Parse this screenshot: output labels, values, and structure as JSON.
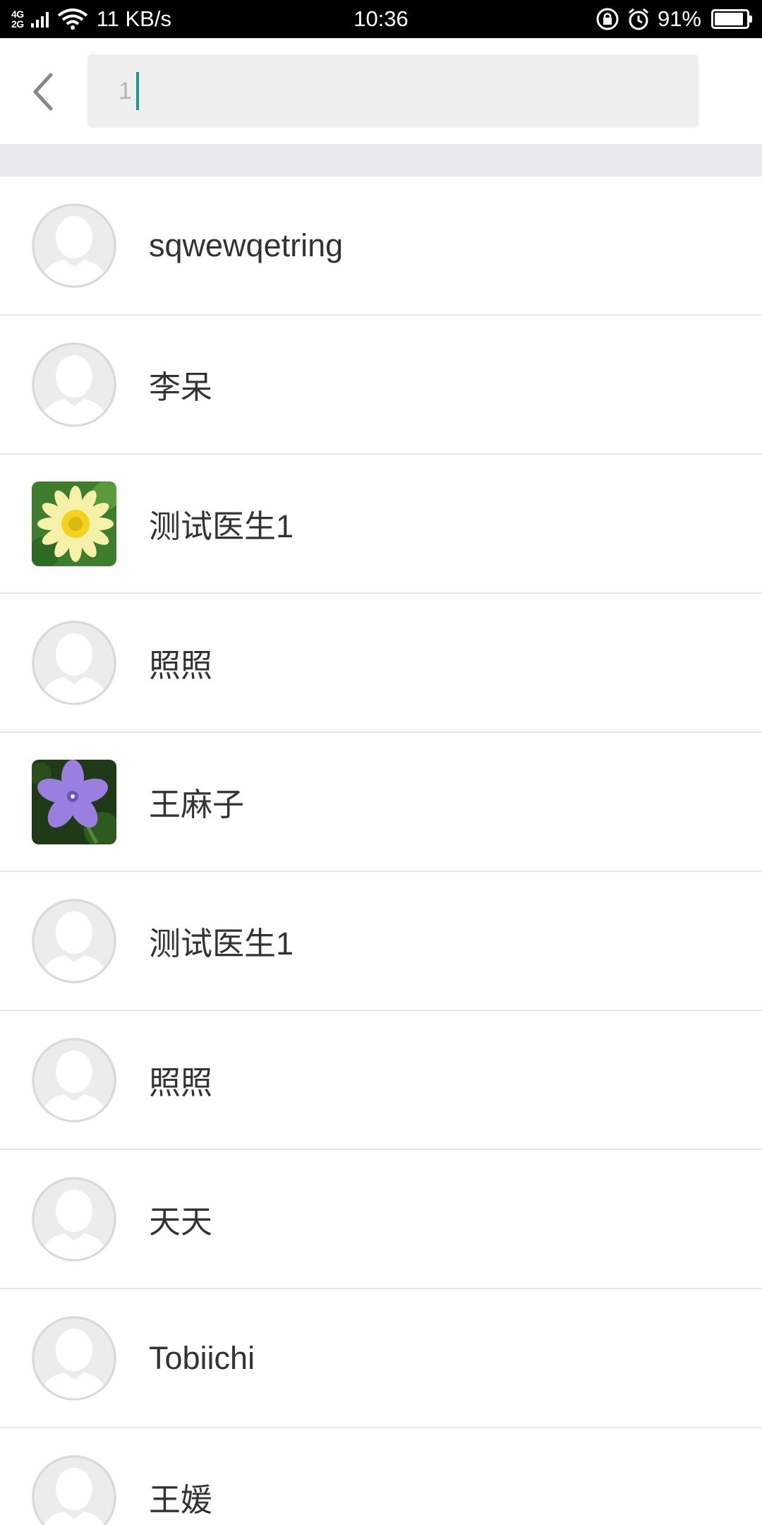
{
  "status_bar": {
    "network_top": "4G",
    "network_bottom": "2G",
    "net_speed": "11 KB/s",
    "time": "10:36",
    "battery_percent": "91%",
    "battery_level": 0.91
  },
  "search": {
    "query": "1",
    "accent_color": "#1a9c8c"
  },
  "contacts": [
    {
      "name": "sqwewqetring",
      "avatar": "default-avatar-icon"
    },
    {
      "name": "李呆",
      "avatar": "default-avatar-icon"
    },
    {
      "name": "测试医生1",
      "avatar": "yellow-flower-photo"
    },
    {
      "name": "照照",
      "avatar": "default-avatar-icon"
    },
    {
      "name": "王麻子",
      "avatar": "purple-flower-photo"
    },
    {
      "name": "测试医生1",
      "avatar": "default-avatar-icon"
    },
    {
      "name": "照照",
      "avatar": "default-avatar-icon"
    },
    {
      "name": "天天",
      "avatar": "default-avatar-icon"
    },
    {
      "name": "Tobiichi",
      "avatar": "default-avatar-icon"
    },
    {
      "name": "王媛",
      "avatar": "default-avatar-icon"
    }
  ]
}
